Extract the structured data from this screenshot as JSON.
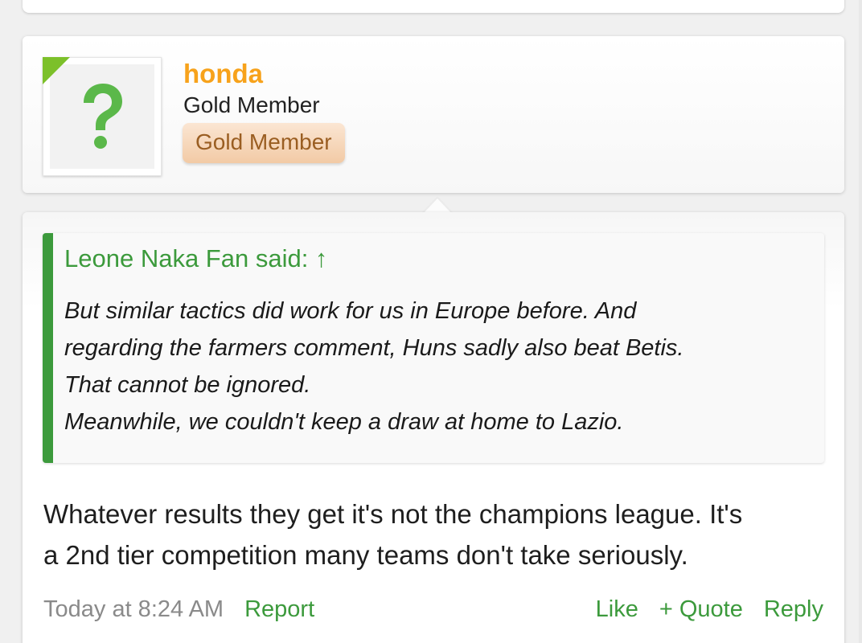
{
  "user": {
    "name": "honda",
    "title": "Gold Member",
    "badge": "Gold Member",
    "avatar_icon": "question-mark-icon"
  },
  "quote": {
    "attribution": "Leone Naka Fan said: ↑",
    "lines": [
      "But similar tactics did work for us in Europe before. And",
      "regarding the farmers comment, Huns sadly also beat Betis.",
      "That cannot be ignored.",
      "Meanwhile, we couldn't keep a draw at home to Lazio."
    ]
  },
  "message": {
    "lines": [
      "Whatever results they get it's not the champions league. It's",
      "a 2nd tier competition many teams don't take seriously."
    ]
  },
  "meta": {
    "timestamp": "Today at 8:24 AM",
    "report": "Report",
    "like": "Like",
    "quote": "+ Quote",
    "reply": "Reply"
  },
  "colors": {
    "link": "#3c9a3c",
    "username": "#f7a21b",
    "badge_text": "#9a5e22",
    "avatar_accent": "#7cc02a"
  }
}
